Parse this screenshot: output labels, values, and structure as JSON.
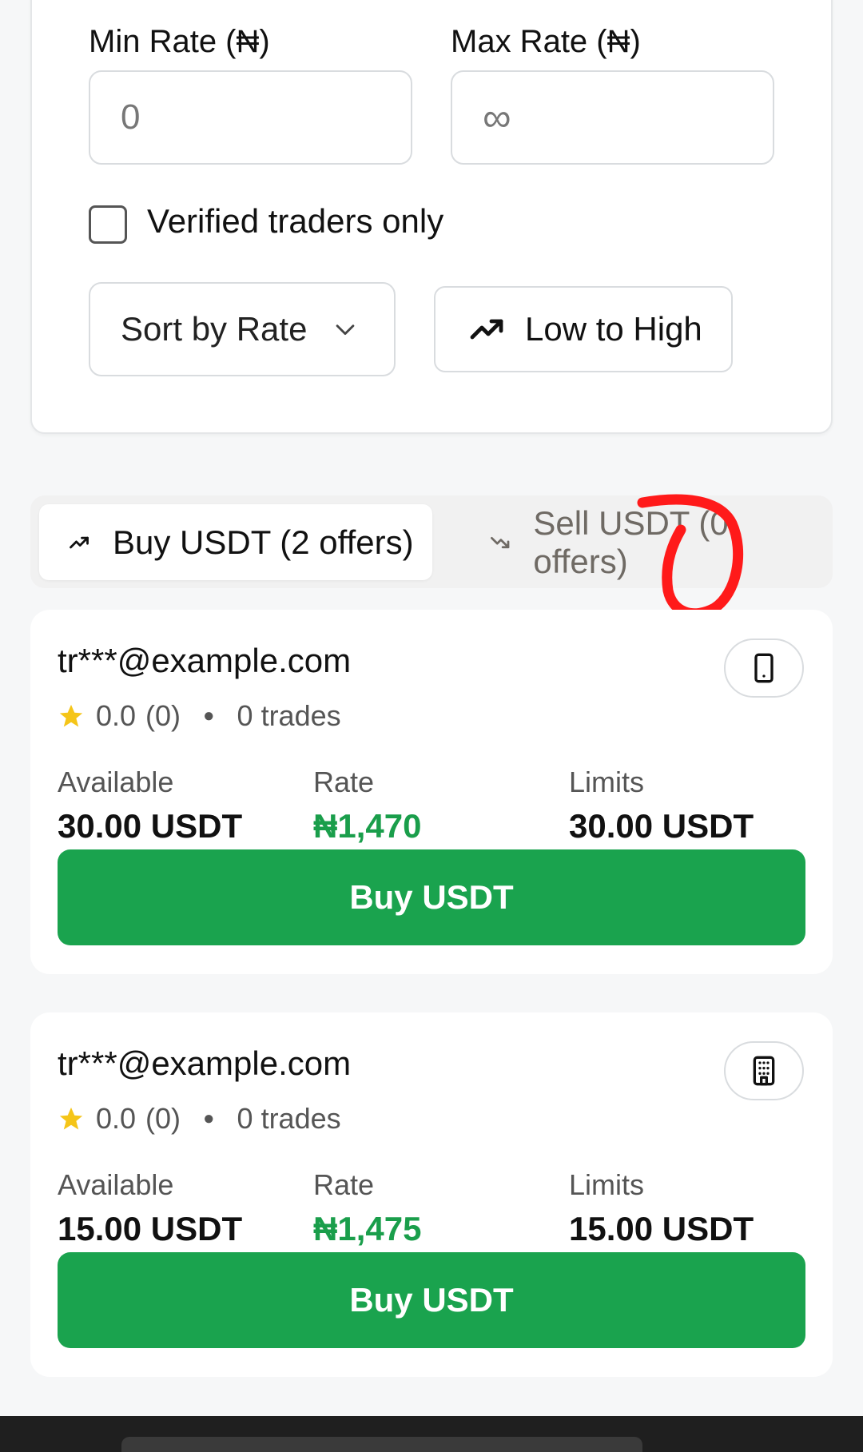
{
  "filters": {
    "min_rate_label": "Min Rate (₦)",
    "max_rate_label": "Max Rate (₦)",
    "min_rate_placeholder": "0",
    "max_rate_placeholder": "∞",
    "verified_label": "Verified traders only",
    "verified_checked": false,
    "sort_selected": "Sort by Rate",
    "order_label": "Low to High"
  },
  "tabs": [
    {
      "label": "Buy USDT (2 offers)",
      "active": true
    },
    {
      "label": "Sell USDT (0 offers)",
      "active": false
    }
  ],
  "offers": [
    {
      "email": "tr***@example.com",
      "rating": "0.0",
      "rating_count": "(0)",
      "trades": "0 trades",
      "payment_icon": "smartphone-icon",
      "available_label": "Available",
      "available": "30.00 USDT",
      "rate_label": "Rate",
      "rate": "₦1,470",
      "limits_label": "Limits",
      "limits": "30.00 USDT",
      "button": "Buy USDT"
    },
    {
      "email": "tr***@example.com",
      "rating": "0.0",
      "rating_count": "(0)",
      "trades": "0 trades",
      "payment_icon": "building-icon",
      "available_label": "Available",
      "available": "15.00 USDT",
      "rate_label": "Rate",
      "rate": "₦1,475",
      "limits_label": "Limits",
      "limits": "15.00 USDT",
      "button": "Buy USDT"
    }
  ],
  "colors": {
    "accent_green": "#1aa34e",
    "rate_green": "#1a9e4b",
    "annotation_red": "#ff1a1a"
  }
}
